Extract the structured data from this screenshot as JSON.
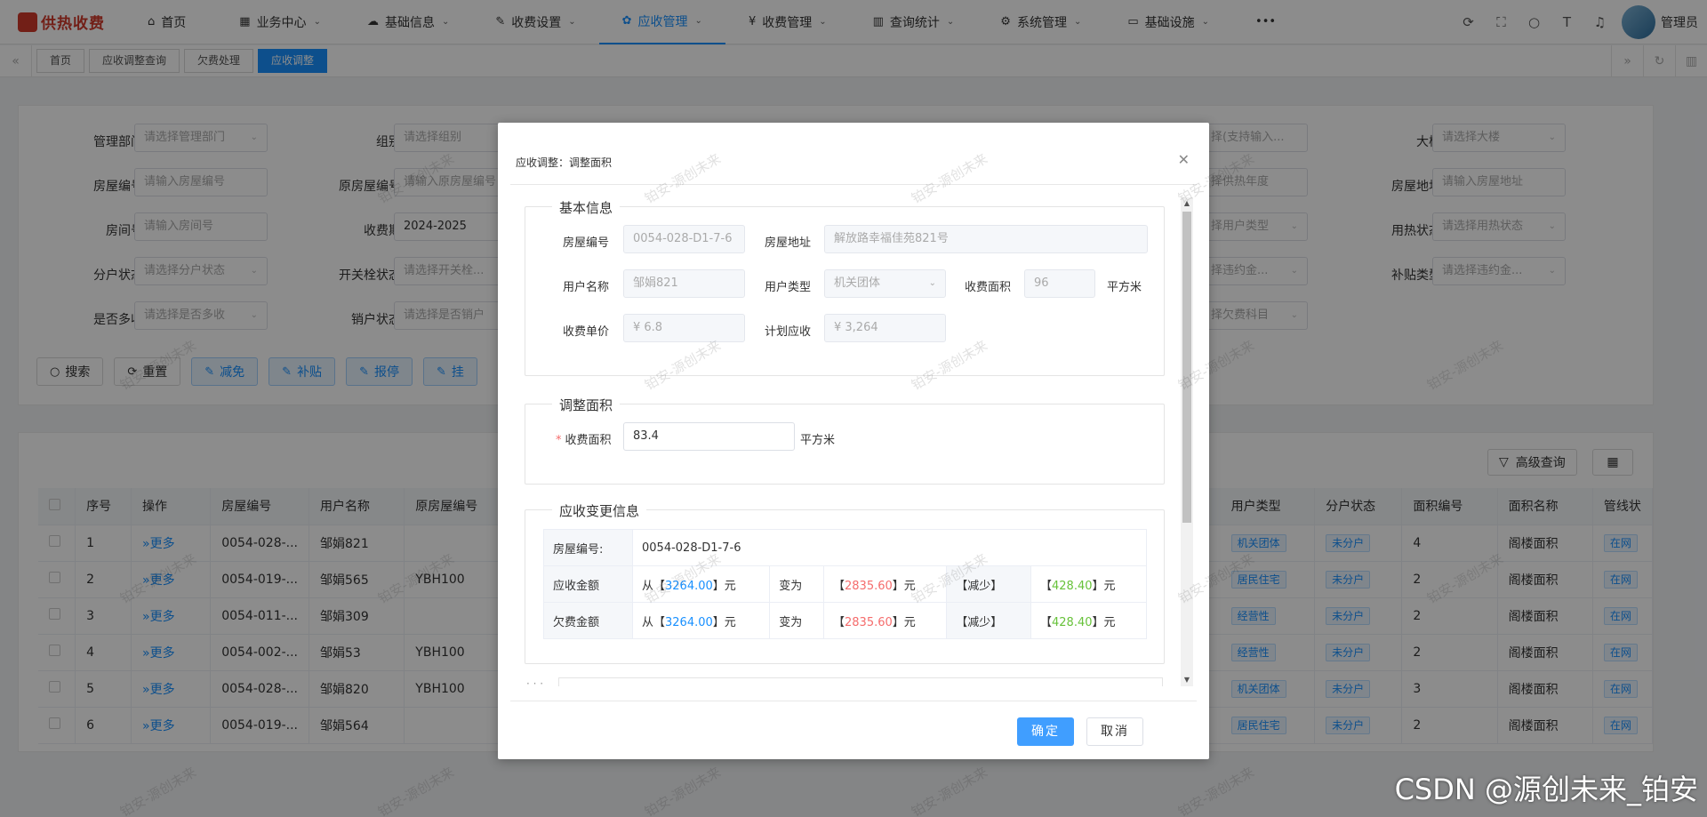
{
  "app": {
    "logo_text": "供热收费",
    "username": "管理员"
  },
  "nav": [
    {
      "icon": "⌂",
      "label": "首页",
      "chev": ""
    },
    {
      "icon": "▦",
      "label": "业务中心",
      "chev": "⌄"
    },
    {
      "icon": "☁",
      "label": "基础信息",
      "chev": "⌄"
    },
    {
      "icon": "✎",
      "label": "收费设置",
      "chev": "⌄"
    },
    {
      "icon": "✿",
      "label": "应收管理",
      "chev": "⌄"
    },
    {
      "icon": "¥",
      "label": "收费管理",
      "chev": "⌄"
    },
    {
      "icon": "▥",
      "label": "查询统计",
      "chev": "⌄"
    },
    {
      "icon": "⚙",
      "label": "系统管理",
      "chev": "⌄"
    },
    {
      "icon": "▭",
      "label": "基础设施",
      "chev": "⌄"
    },
    {
      "icon": "•••",
      "label": "",
      "chev": ""
    }
  ],
  "tabs": [
    "首页",
    "应收调整查询",
    "欠费处理",
    "应收调整"
  ],
  "filter": {
    "labels": [
      "管理部门",
      "组别",
      "大楼",
      "房屋编号",
      "原房屋编号",
      "房屋地址",
      "房间号",
      "收费期",
      "用热状态",
      "分户状态",
      "开关栓状态",
      "补贴类型",
      "是否多收",
      "销户状态"
    ],
    "placeholders": [
      "请选择管理部门",
      "请选择组别",
      "请选择大楼",
      "请输入房屋编号",
      "请输入原房屋编号",
      "请输入房屋地址",
      "请输入房间号",
      "2024-2025",
      "请选择用热状态",
      "请选择分户状态",
      "请选择开关栓...",
      "请选择违约金...",
      "请选择是否多收",
      "请选择是否销户"
    ],
    "right_fragments": [
      "择(支持输入...",
      "择供热年度",
      "择用户类型",
      "择违约金...",
      "择欠费科目"
    ],
    "buttons": [
      "搜索",
      "重置",
      "减免",
      "补贴",
      "报停",
      "挂"
    ]
  },
  "table": {
    "tools": [
      "高级查询"
    ],
    "headers": [
      "序号",
      "操作",
      "房屋编号",
      "用户名称",
      "原房屋编号",
      "用户类型",
      "分户状态",
      "面积编号",
      "面积名称",
      "管线状"
    ],
    "more_label": "更多",
    "rows": [
      {
        "no": "1",
        "house": "0054-028-...",
        "user": "邹娟821",
        "orig": "",
        "utype": "机关团体",
        "split": "未分户",
        "area_no": "4",
        "area_name": "阁楼面积",
        "pipe": "在网"
      },
      {
        "no": "2",
        "house": "0054-019-...",
        "user": "邹娟565",
        "orig": "YBH100",
        "utype": "居民住宅",
        "split": "未分户",
        "area_no": "2",
        "area_name": "阁楼面积",
        "pipe": "在网"
      },
      {
        "no": "3",
        "house": "0054-011-...",
        "user": "邹娟309",
        "orig": "",
        "utype": "经营性",
        "split": "未分户",
        "area_no": "2",
        "area_name": "阁楼面积",
        "pipe": "在网"
      },
      {
        "no": "4",
        "house": "0054-002-...",
        "user": "邹娟53",
        "orig": "YBH100",
        "utype": "经营性",
        "split": "未分户",
        "area_no": "2",
        "area_name": "阁楼面积",
        "pipe": "在网"
      },
      {
        "no": "5",
        "house": "0054-028-...",
        "user": "邹娟820",
        "orig": "YBH100",
        "utype": "机关团体",
        "split": "未分户",
        "area_no": "3",
        "area_name": "阁楼面积",
        "pipe": "在网"
      },
      {
        "no": "6",
        "house": "0054-019-...",
        "user": "邹娟564",
        "orig": "",
        "utype": "居民住宅",
        "split": "未分户",
        "area_no": "2",
        "area_name": "阁楼面积",
        "pipe": "在网"
      }
    ]
  },
  "dialog": {
    "title": "应收调整：调整面积",
    "basic": {
      "legend": "基本信息",
      "house_no_label": "房屋编号",
      "house_no": "0054-028-D1-7-6",
      "address_label": "房屋地址",
      "address": "解放路幸福佳苑821号",
      "user_label": "用户名称",
      "user": "邹娟821",
      "utype_label": "用户类型",
      "utype": "机关团体",
      "area_label": "收费面积",
      "area": "96",
      "area_unit": "平方米",
      "price_label": "收费单价",
      "price": "¥ 6.8",
      "plan_label": "计划应收",
      "plan": "¥ 3,264"
    },
    "adjust": {
      "legend": "调整面积",
      "area_label": "收费面积",
      "area": "83.4",
      "unit": "平方米"
    },
    "change": {
      "legend": "应收变更信息",
      "house_label": "房屋编号:",
      "house": "0054-028-D1-7-6",
      "rows": [
        {
          "label": "应收金额",
          "from_pre": "从【",
          "from": "3264.00",
          "from_post": "】元",
          "to_label": "变为",
          "to_pre": "【",
          "to": "2835.60",
          "to_post": "】元",
          "dir": "【减少】",
          "diff_pre": "【",
          "diff": "428.40",
          "diff_post": "】元"
        },
        {
          "label": "欠费金额",
          "from_pre": "从【",
          "from": "3264.00",
          "from_post": "】元",
          "to_label": "变为",
          "to_pre": "【",
          "to": "2835.60",
          "to_post": "】元",
          "dir": "【减少】",
          "diff_pre": "【",
          "diff": "428.40",
          "diff_post": "】元"
        }
      ]
    },
    "ok": "确定",
    "cancel": "取消"
  },
  "watermark": "铂安-源创未来",
  "credit": "CSDN @源创未来_铂安"
}
